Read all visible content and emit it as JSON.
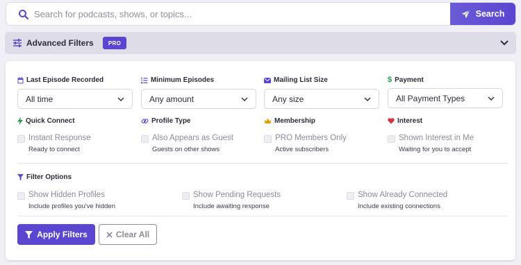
{
  "search": {
    "placeholder": "Search for podcasts, shows, or topics...",
    "value": "",
    "button_label": "Search"
  },
  "advanced": {
    "title": "Advanced Filters",
    "badge": "PRO"
  },
  "dropdowns": [
    {
      "label": "Last Episode Recorded",
      "icon": "calendar-icon",
      "value": "All time"
    },
    {
      "label": "Minimum Episodes",
      "icon": "numbered-list-icon",
      "value": "Any amount"
    },
    {
      "label": "Mailing List Size",
      "icon": "envelope-icon",
      "value": "Any size"
    },
    {
      "label": "Payment",
      "icon": "dollar-icon",
      "value": "All Payment Types"
    }
  ],
  "check_groups": [
    {
      "label": "Quick Connect",
      "icon": "bolt-icon",
      "option": "Instant Response",
      "sub": "Ready to connect"
    },
    {
      "label": "Profile Type",
      "icon": "link-icon",
      "option": "Also Appears as Guest",
      "sub": "Guests on other shows"
    },
    {
      "label": "Membership",
      "icon": "crown-icon",
      "option": "PRO Members Only",
      "sub": "Active subscribers"
    },
    {
      "label": "Interest",
      "icon": "heart-icon",
      "option": "Shown Interest in Me",
      "sub": "Waiting for you to accept"
    }
  ],
  "filter_options": {
    "label": "Filter Options",
    "icon": "funnel-icon",
    "items": [
      {
        "option": "Show Hidden Profiles",
        "sub": "Include profiles you've hidden"
      },
      {
        "option": "Show Pending Requests",
        "sub": "Include awaiting response"
      },
      {
        "option": "Show Already Connected",
        "sub": "Include existing connections"
      }
    ]
  },
  "actions": {
    "apply": "Apply Filters",
    "clear": "Clear All"
  },
  "colors": {
    "accent": "#5a46d0",
    "payment": "#1f9e4a",
    "bolt": "#1f9e4a",
    "crown": "#e0a100",
    "heart": "#d6303c"
  }
}
